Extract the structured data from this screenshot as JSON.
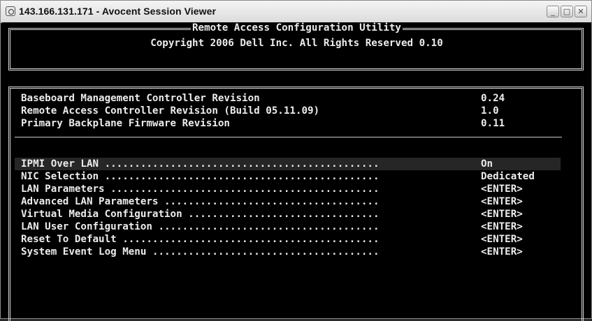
{
  "window": {
    "title": "143.166.131.171 - Avocent Session Viewer",
    "controls": {
      "minimize": "_",
      "maximize": "□",
      "close": "✕"
    }
  },
  "header": {
    "title": "Remote Access Configuration Utility",
    "copyright": "Copyright 2006 Dell Inc. All Rights Reserved 0.10"
  },
  "revisions": [
    {
      "label": "Baseboard Management Controller Revision",
      "value": "0.24"
    },
    {
      "label": "Remote Access Controller Revision (Build 05.11.09)",
      "value": "1.0"
    },
    {
      "label": "Primary Backplane Firmware Revision",
      "value": "0.11"
    }
  ],
  "menu": [
    {
      "label": "IPMI Over LAN ..............................................",
      "value": "On",
      "selected": true
    },
    {
      "label": "NIC Selection ..............................................",
      "value": "Dedicated"
    },
    {
      "label": "LAN Parameters .............................................",
      "value": "<ENTER>"
    },
    {
      "label": "Advanced LAN Parameters ....................................",
      "value": "<ENTER>"
    },
    {
      "label": "Virtual Media Configuration ................................",
      "value": "<ENTER>"
    },
    {
      "label": "LAN User Configuration .....................................",
      "value": "<ENTER>"
    },
    {
      "label": "Reset To Default ...........................................",
      "value": "<ENTER>"
    },
    {
      "label": "System Event Log Menu ......................................",
      "value": "<ENTER>"
    }
  ],
  "colors": {
    "console_bg": "#000000",
    "console_fg": "#ececec",
    "selection": "#262626"
  },
  "icons": {
    "app": "session-viewer-icon",
    "min": "minimize-icon",
    "max": "maximize-icon",
    "close": "close-icon"
  }
}
